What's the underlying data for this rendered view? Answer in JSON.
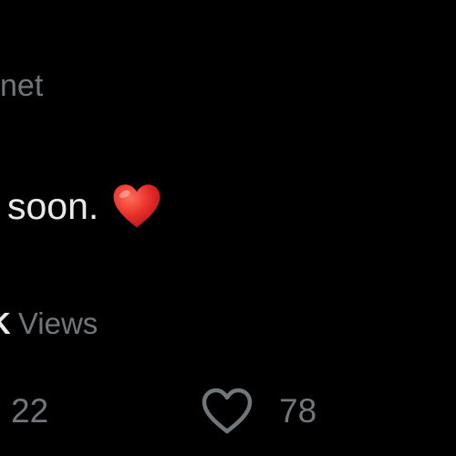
{
  "author": {
    "handle_fragment": "net"
  },
  "tweet": {
    "text_fragment": "soon.",
    "emoji_icon": "red-heart-emoji"
  },
  "stats": {
    "views_number_fragment": "K",
    "views_label": "Views"
  },
  "actions": {
    "reply_count": "22",
    "like_count": "78",
    "like_icon": "heart-outline-icon"
  },
  "colors": {
    "background": "#000000",
    "primary_text": "#e7e9ea",
    "secondary_text": "#71767b",
    "emoji_red": "#e8302a"
  }
}
